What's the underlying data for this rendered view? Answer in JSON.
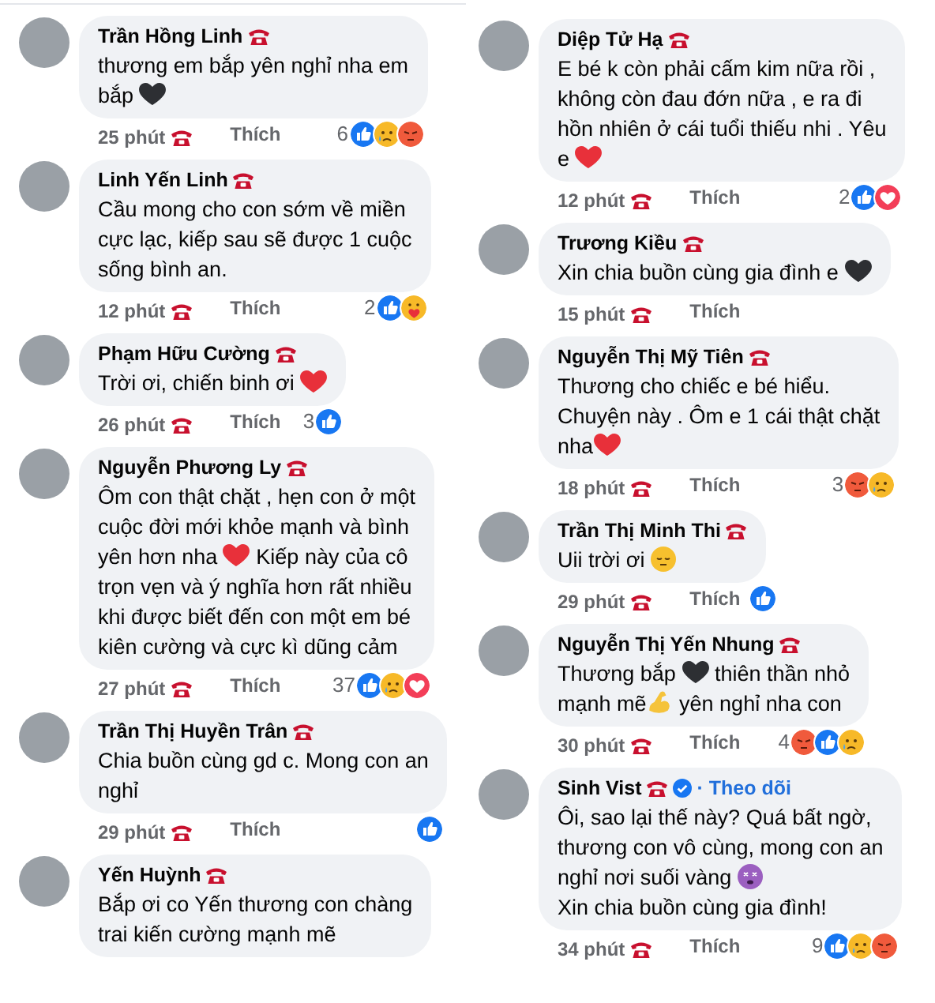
{
  "columns": [
    {
      "comments": [
        {
          "author": "Trần Hồng Linh",
          "lines": [
            [
              {
                "kind": "text",
                "text": "thương em bắp yên nghỉ nha em"
              }
            ],
            [
              {
                "kind": "text",
                "text": "bắp "
              },
              {
                "kind": "heart",
                "color": "#2d2f33"
              }
            ]
          ],
          "time": "25 phút",
          "like_action": "Thích",
          "reaction_count": "6",
          "reactions": [
            {
              "kind": "like"
            },
            {
              "kind": "sad"
            },
            {
              "kind": "angry"
            }
          ]
        },
        {
          "author": "Linh Yến Linh",
          "lines": [
            [
              {
                "kind": "text",
                "text": "Cầu mong cho con sớm về miền"
              }
            ],
            [
              {
                "kind": "text",
                "text": "cực lạc, kiếp sau sẽ được 1 cuộc"
              }
            ],
            [
              {
                "kind": "text",
                "text": "sống bình an."
              }
            ]
          ],
          "time": "12 phút",
          "like_action": "Thích",
          "reaction_count": "2",
          "reactions": [
            {
              "kind": "like"
            },
            {
              "kind": "care"
            }
          ]
        },
        {
          "author": "Phạm Hữu Cường",
          "lines": [
            [
              {
                "kind": "text",
                "text": "Trời ơi, chiến binh ơi "
              },
              {
                "kind": "heart",
                "color": "#e8303a"
              }
            ]
          ],
          "time": "26 phút",
          "like_action": "Thích",
          "reaction_count": "3",
          "reactions": [
            {
              "kind": "like"
            }
          ]
        },
        {
          "author": "Nguyễn Phương Ly",
          "lines": [
            [
              {
                "kind": "text",
                "text": "Ôm con thật chặt , hẹn con ở một"
              }
            ],
            [
              {
                "kind": "text",
                "text": "cuộc đời mới khỏe mạnh và bình"
              }
            ],
            [
              {
                "kind": "text",
                "text": "yên hơn nha "
              },
              {
                "kind": "heart",
                "color": "#e8303a"
              },
              {
                "kind": "text",
                "text": " Kiếp này của cô"
              }
            ],
            [
              {
                "kind": "text",
                "text": "trọn vẹn và ý nghĩa hơn rất nhiều"
              }
            ],
            [
              {
                "kind": "text",
                "text": "khi được biết đến con một em bé"
              }
            ],
            [
              {
                "kind": "text",
                "text": "kiên cường và cực kì dũng cảm"
              }
            ]
          ],
          "time": "27 phút",
          "like_action": "Thích",
          "reaction_count": "37",
          "reactions": [
            {
              "kind": "like"
            },
            {
              "kind": "sad"
            },
            {
              "kind": "love"
            }
          ]
        },
        {
          "author": "Trần Thị Huyền Trân",
          "lines": [
            [
              {
                "kind": "text",
                "text": "Chia buồn cùng gd c. Mong con an"
              }
            ],
            [
              {
                "kind": "text",
                "text": "nghỉ"
              }
            ]
          ],
          "time": "29 phút",
          "like_action": "Thích",
          "reactions": [
            {
              "kind": "like"
            }
          ]
        },
        {
          "author": "Yến Huỳnh",
          "lines": [
            [
              {
                "kind": "text",
                "text": "Bắp ơi co Yến thương con chàng"
              }
            ],
            [
              {
                "kind": "text",
                "text": "trai kiến cường mạnh mẽ"
              }
            ]
          ]
        }
      ]
    },
    {
      "comments": [
        {
          "author": "Diệp Tử Hạ",
          "lines": [
            [
              {
                "kind": "text",
                "text": "E bé k còn phải cấm kim nữa rồi ,"
              }
            ],
            [
              {
                "kind": "text",
                "text": "không còn đau đớn nữa , e ra đi"
              }
            ],
            [
              {
                "kind": "text",
                "text": "hồn nhiên ở cái tuổi thiếu nhi . Yêu"
              }
            ],
            [
              {
                "kind": "text",
                "text": "e "
              },
              {
                "kind": "heart",
                "color": "#e8303a"
              }
            ]
          ],
          "time": "12 phút",
          "like_action": "Thích",
          "reaction_count": "2",
          "reactions": [
            {
              "kind": "like"
            },
            {
              "kind": "love"
            }
          ]
        },
        {
          "author": "Trương Kiều",
          "lines": [
            [
              {
                "kind": "text",
                "text": "Xin chia buồn cùng gia đình e "
              },
              {
                "kind": "heart",
                "color": "#2d2f33"
              }
            ]
          ],
          "time": "15 phút",
          "like_action": "Thích"
        },
        {
          "author": "Nguyễn Thị Mỹ Tiên",
          "lines": [
            [
              {
                "kind": "text",
                "text": "Thương cho chiếc e bé hiểu."
              }
            ],
            [
              {
                "kind": "text",
                "text": "Chuyện này . Ôm e 1 cái thật chặt"
              }
            ],
            [
              {
                "kind": "text",
                "text": "nha"
              },
              {
                "kind": "heart",
                "color": "#e8303a"
              }
            ]
          ],
          "time": "18 phút",
          "like_action": "Thích",
          "reaction_count": "3",
          "reactions": [
            {
              "kind": "angry"
            },
            {
              "kind": "sad"
            }
          ]
        },
        {
          "author": "Trần Thị Minh Thi",
          "lines": [
            [
              {
                "kind": "text",
                "text": "Uii trời ơi "
              },
              {
                "kind": "pensive_face"
              }
            ]
          ],
          "time": "29 phút",
          "like_action": "Thích",
          "reactions": [
            {
              "kind": "like"
            }
          ]
        },
        {
          "author": "Nguyễn Thị Yến Nhung",
          "lines": [
            [
              {
                "kind": "text",
                "text": "Thương bắp "
              },
              {
                "kind": "heart",
                "color": "#2d2f33"
              },
              {
                "kind": "text",
                "text": " thiên thần nhỏ"
              }
            ],
            [
              {
                "kind": "text",
                "text": "mạnh mẽ"
              },
              {
                "kind": "flexed_arm"
              },
              {
                "kind": "text",
                "text": " yên nghỉ nha con"
              }
            ]
          ],
          "time": "30 phút",
          "like_action": "Thích",
          "reaction_count": "4",
          "reactions": [
            {
              "kind": "angry"
            },
            {
              "kind": "like"
            },
            {
              "kind": "sad"
            }
          ]
        },
        {
          "author": "Sinh Vist",
          "verified": true,
          "follow": "· Theo dõi",
          "lines": [
            [
              {
                "kind": "text",
                "text": "Ôi, sao lại thế này? Quá bất ngờ,"
              }
            ],
            [
              {
                "kind": "text",
                "text": "thương con vô cùng, mong con an"
              }
            ],
            [
              {
                "kind": "text",
                "text": "nghỉ nơi suối vàng "
              },
              {
                "kind": "dizzy_face"
              }
            ],
            [
              {
                "kind": "text",
                "text": "Xin chia buồn cùng gia đình!"
              }
            ]
          ],
          "time": "34 phút",
          "like_action": "Thích",
          "reaction_count": "9",
          "reactions": [
            {
              "kind": "like"
            },
            {
              "kind": "sad"
            },
            {
              "kind": "angry"
            }
          ]
        }
      ]
    }
  ]
}
